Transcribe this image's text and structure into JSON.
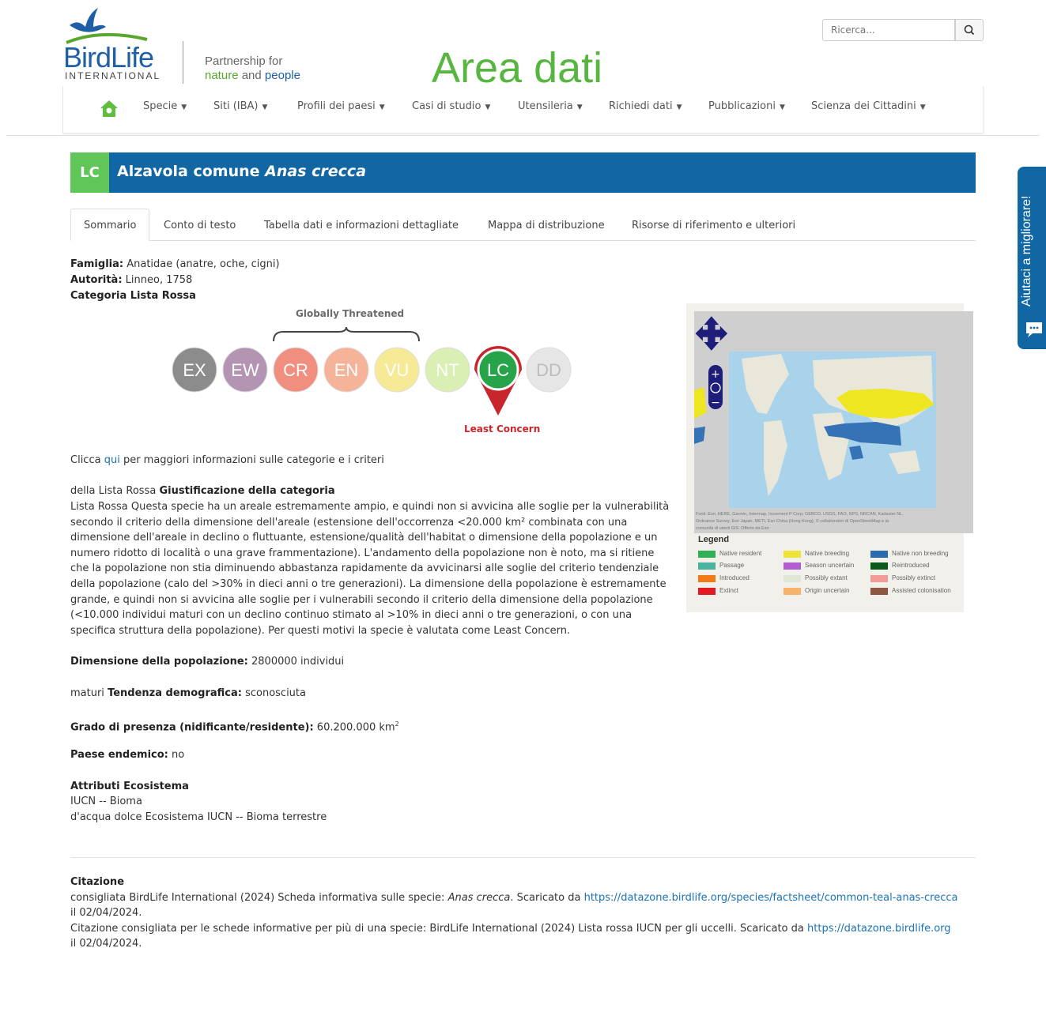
{
  "header": {
    "logo_word": "BirdLife",
    "logo_sub": "INTERNATIONAL",
    "tagline_line1": "Partnership for",
    "tagline_nature": "nature",
    "tagline_and": " and ",
    "tagline_people": "people",
    "area_title": "Area dati",
    "search_placeholder": "Ricerca..."
  },
  "nav": {
    "items": [
      "Specie",
      "Siti (IBA)",
      "Profili dei paesi",
      "Casi di studio",
      "Utensileria",
      "Richiedi dati",
      "Pubblicazioni",
      "Scienza dei Cittadini"
    ]
  },
  "banner": {
    "code": "LC",
    "common_name": "Alzavola comune",
    "scientific_name": "Anas crecca"
  },
  "tabs": [
    "Sommario",
    "Conto di testo",
    "Tabella dati e informazioni dettagliate",
    "Mappa di distribuzione",
    "Risorse di riferimento e ulteriori"
  ],
  "summary": {
    "family_label": "Famiglia:",
    "family_value": "Anatidae (anatre, oche, cigni)",
    "authority_label": "Autorità:",
    "authority_value": "Linneo, 1758",
    "redlist_label": "Categoria Lista Rossa"
  },
  "redlist_scale": {
    "group_label": "Globally Threatened",
    "categories": [
      "EX",
      "EW",
      "CR",
      "EN",
      "VU",
      "NT",
      "LC",
      "DD"
    ],
    "colors": [
      "#8c8c8c",
      "#b395b3",
      "#f08f80",
      "#f5b49a",
      "#f7ea96",
      "#d9efb3",
      "#27a44a",
      "#e6e6e6"
    ],
    "selected": "LC",
    "selected_label": "Least Concern"
  },
  "click_info": {
    "prefix": "Clicca",
    "link": "qui",
    "suffix": "per maggiori informazioni sulle categorie e i criteri"
  },
  "justification": {
    "prefix": "della Lista Rossa",
    "heading": "Giustificazione della categoria",
    "lines": [
      "Lista Rossa Questa specie ha un areale estremamente ampio, e quindi non si avvicina alle soglie per la vulnerabilità",
      "secondo il criterio della dimensione dell'areale (estensione dell'occorrenza <20.000 km² combinata con una",
      "dimensione dell'areale in declino o fluttuante, estensione/qualità dell'habitat o dimensione della popolazione e un",
      "numero ridotto di località o una grave frammentazione). L'andamento della popolazione non è noto, ma si ritiene",
      "che la popolazione non stia diminuendo abbastanza rapidamente da avvicinarsi alle soglie del criterio tendenziale",
      "della popolazione (calo del >30% in dieci anni o tre generazioni). La dimensione della popolazione è estremamente",
      "grande, e quindi non si avvicina alle soglie per i vulnerabili secondo il criterio della dimensione della popolazione",
      "(<10.000 individui maturi con un declino continuo stimato al >10% in dieci anni o tre generazioni, o con una",
      "specifica struttura della popolazione). Per questi motivi la specie è valutata come Least Concern."
    ]
  },
  "facts": {
    "population_label": "Dimensione della popolazione:",
    "population_value": "2800000 individui",
    "trend_prefix": "maturi",
    "trend_label": "Tendenza demografica:",
    "trend_value": "sconosciuta",
    "range_label": "Grado di presenza (nidificante/residente):",
    "range_value": "60.200.000 km",
    "range_sup": "2",
    "endemic_label": "Paese endemico:",
    "endemic_value": "no",
    "eco_label": "Attributi Ecosistema",
    "eco_line1": "IUCN -- Bioma",
    "eco_line2": "d'acqua dolce Ecosistema IUCN -- Bioma terrestre"
  },
  "citation": {
    "title": "Citazione",
    "line1_prefix": "consigliata BirdLife International (2024) Scheda informativa sulle specie:",
    "line1_species": "Anas crecca",
    "line1_mid": ". Scaricato da",
    "line1_url": "https://datazone.birdlife.org/species/factsheet/common-teal-anas-crecca",
    "line1_date": "il 02/04/2024.",
    "line2_prefix": "Citazione consigliata per le schede informative per più di una specie: BirdLife International (2024) Lista rossa IUCN per gli uccelli. Scaricato da",
    "line2_url": "https://datazone.birdlife.org",
    "line2_date": "il 02/04/2024."
  },
  "map": {
    "attribution_line1": "Fonti: Esri, HERE, Garmin, Intermap, Increment P Corp, GEBCO, USGS, FAO, NPS, NRCAN, Kadaster NL,",
    "attribution_line2": "Ordnance Survey, Esri Japan, METI, Esri China (Hong Kong), © collaboratori di OpenStreetMap e la",
    "attribution_line3": "comunità di utenti GIS. Offerto da Esri",
    "legend_title": "Legend",
    "legend": [
      {
        "label": "Native resident",
        "color": "#2fb056"
      },
      {
        "label": "Native breeding",
        "color": "#ece43a"
      },
      {
        "label": "Native non breeding",
        "color": "#2b6cb0"
      },
      {
        "label": "Passage",
        "color": "#49b49b"
      },
      {
        "label": "Season uncertain",
        "color": "#b05ed0"
      },
      {
        "label": "Reintroduced",
        "color": "#0b5a1c"
      },
      {
        "label": "Introduced",
        "color": "#f47a18"
      },
      {
        "label": "Possibly extant",
        "color": "#dfe7d6"
      },
      {
        "label": "Possibly extinct",
        "color": "#f29a96"
      },
      {
        "label": "Extinct",
        "color": "#e21b23"
      },
      {
        "label": "Origin uncertain",
        "color": "#f7b36b"
      },
      {
        "label": "Assisted colonisation",
        "color": "#8e5742"
      }
    ]
  },
  "feedback": {
    "label": "Aiutaci a migliorare!"
  }
}
